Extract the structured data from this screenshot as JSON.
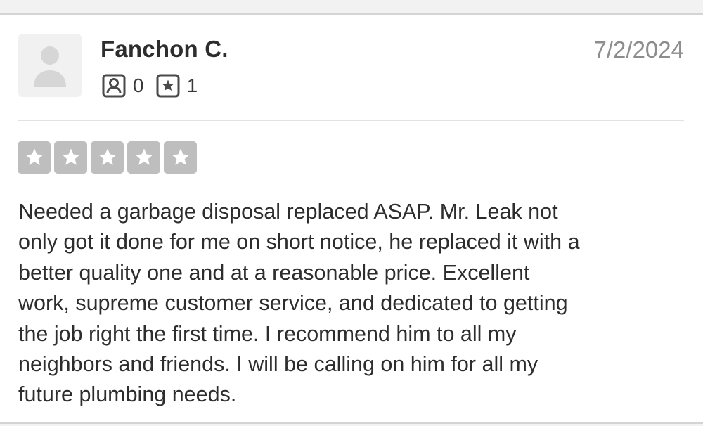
{
  "review": {
    "reviewer_name": "Fanchon C.",
    "date": "7/2/2024",
    "stats": {
      "friends_icon": "friends-icon",
      "friends_count": "0",
      "reviews_icon": "reviews-star-icon",
      "reviews_count": "1"
    },
    "rating": {
      "value": 5,
      "max": 5,
      "star_color": "#bebebe"
    },
    "text": "Needed a garbage disposal replaced ASAP.  Mr. Leak not\nonly got it done for me on short notice, he replaced it with a\nbetter quality one and at a reasonable price.  Excellent\nwork, supreme customer service, and dedicated to getting\nthe job right the first time.  I recommend him to all my\nneighbors and friends.  I will be calling on him for all my\nfuture plumbing needs."
  }
}
